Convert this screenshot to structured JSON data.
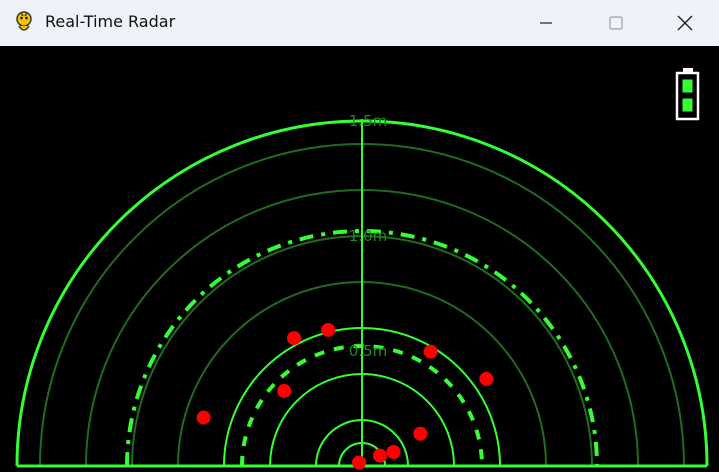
{
  "window": {
    "title": "Real-Time Radar",
    "app_icon": "pygame-snake-icon",
    "controls": {
      "minimize_icon": "minimize-icon",
      "maximize_icon": "maximize-icon",
      "close_icon": "close-icon"
    }
  },
  "radar": {
    "background_color": "#000000",
    "grid_color": "#33ff33",
    "dim_grid_color": "#1f6b1f",
    "target_color": "#ff0000",
    "range_labels": [
      "1.5m",
      "1.0m",
      "0.5m"
    ],
    "max_range_m": 1.5,
    "targets": [
      {
        "distance_m": 0.58,
        "angle_deg": 59
      },
      {
        "distance_m": 0.66,
        "angle_deg": 35
      },
      {
        "distance_m": 0.63,
        "angle_deg": 118
      },
      {
        "distance_m": 0.61,
        "angle_deg": 104
      },
      {
        "distance_m": 0.47,
        "angle_deg": 136
      },
      {
        "distance_m": 0.29,
        "angle_deg": 29
      },
      {
        "distance_m": 0.72,
        "angle_deg": 163
      },
      {
        "distance_m": 0.15,
        "angle_deg": 24
      },
      {
        "distance_m": 0.09,
        "angle_deg": 30
      },
      {
        "distance_m": 0.02,
        "angle_deg": 130
      }
    ]
  },
  "battery": {
    "icon": "battery-icon",
    "level_bars": 2,
    "max_bars": 2,
    "fill_color": "#33ff33"
  }
}
